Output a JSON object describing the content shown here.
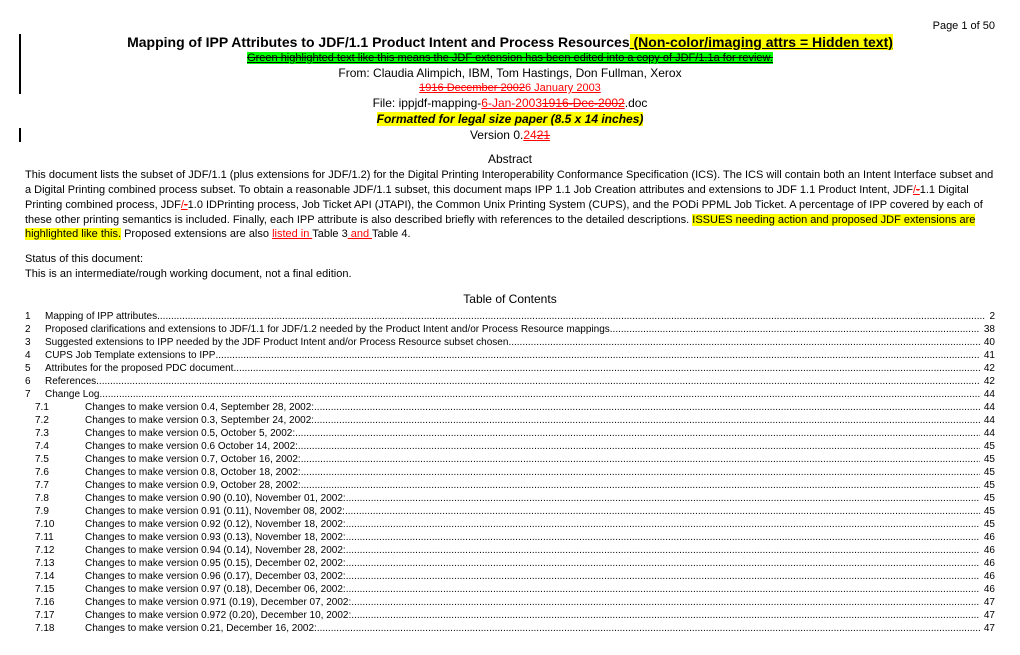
{
  "pageNum": "Page 1 of 50",
  "title": "Mapping of IPP Attributes to JDF/1.1 Product Intent and Process Resources",
  "titleSubtitle": " (Non-color/imaging attrs = Hidden text)",
  "greenLine": "Green highlighted text like this means the JDF extension has been edited into a copy of JDF/1.1a for review.",
  "fromLine": "From: Claudia Alimpich, IBM, Tom Hastings, Don Fullman, Xerox",
  "dateStrike1": "1916 December 2002",
  "dateNew": "6 January 2003",
  "filePrefix": "File: ippjdf-mapping-",
  "fileNew": "6-Jan-2003",
  "fileStrike": "1916-Dec-2002",
  "fileSuffix": ".doc",
  "formatLine": "Formatted for legal size paper (8.5 x 14 inches)",
  "versionPrefix": "Version  0.",
  "versionNew": "24",
  "versionOld": "21",
  "abstractTitle": "Abstract",
  "abstractText1": "This document lists the subset of JDF/1.1 (plus extensions for JDF/1.2) for the Digital Printing Interoperability Conformance Specification (ICS).  The ICS will contain both an Intent Interface subset and a Digital Printing combined process subset.  To obtain a reasonable JDF/1.1 subset, this document maps IPP 1.1 Job Creation attributes and extensions to JDF 1.1 Product Intent, JDF",
  "abstractSlash": "/-",
  "abstractText2": "1.1 Digital Printing combined process, JDF",
  "abstractSlash2": "/-",
  "abstractText3": "1.0 IDPrinting process, Job Ticket API (JTAPI),  the Common Unix Printing System (CUPS), and the PODi PPML Job Ticket.  A percentage of IPP covered by each of these other printing semantics is included.  Finally, each IPP attribute is also described briefly with references to the detailed descriptions.  ",
  "abstractHighlight": "ISSUES needing action and proposed JDF extensions are highlighted like this.",
  "abstractText4": "  Proposed extensions are also ",
  "abstractLink1": "listed in ",
  "abstractText5": "Table 3",
  "abstractLink2": " and ",
  "abstractText6": "Table 4.",
  "statusTitle": "Status of this document:",
  "statusText": "This is an intermediate/rough working document, not a final edition.",
  "tocTitle": "Table of Contents",
  "toc": [
    {
      "num": "1",
      "text": "Mapping of IPP attributes",
      "page": "2"
    },
    {
      "num": "2",
      "text": "Proposed clarifications and extensions to JDF/1.1 for JDF/1.2 needed by the Product Intent and/or Process Resource mappings",
      "page": "38"
    },
    {
      "num": "3",
      "text": "Suggested extensions to IPP needed by the JDF Product Intent and/or Process Resource subset chosen",
      "page": "40"
    },
    {
      "num": "4",
      "text": "CUPS Job Template extensions to IPP",
      "page": "41"
    },
    {
      "num": "5",
      "text": "Attributes for the proposed PDC document",
      "page": "42"
    },
    {
      "num": "6",
      "text": "References",
      "page": "42"
    },
    {
      "num": "7",
      "text": "Change Log",
      "page": "44"
    }
  ],
  "tocSub": [
    {
      "num": "7.1",
      "text": "Changes to make version 0.4, September 28, 2002:",
      "page": "44"
    },
    {
      "num": "7.2",
      "text": "Changes to make version 0.3, September 24, 2002:",
      "page": "44"
    },
    {
      "num": "7.3",
      "text": "Changes to make version 0.5, October 5, 2002:",
      "page": "44"
    },
    {
      "num": "7.4",
      "text": "Changes to make version 0.6 October 14, 2002:",
      "page": "45"
    },
    {
      "num": "7.5",
      "text": "Changes to make version 0.7, October 16, 2002:",
      "page": "45"
    },
    {
      "num": "7.6",
      "text": "Changes to make version 0.8, October 18, 2002:",
      "page": "45"
    },
    {
      "num": "7.7",
      "text": "Changes to make version 0.9, October 28, 2002:",
      "page": "45"
    },
    {
      "num": "7.8",
      "text": "Changes to make version 0.90 (0.10), November 01, 2002:",
      "page": "45"
    },
    {
      "num": "7.9",
      "text": "Changes to make version 0.91 (0.11), November 08, 2002:",
      "page": "45"
    },
    {
      "num": "7.10",
      "text": "Changes to make version 0.92 (0.12), November 18, 2002:",
      "page": "45"
    },
    {
      "num": "7.11",
      "text": "Changes to make version 0.93 (0.13), November 18, 2002:",
      "page": "46"
    },
    {
      "num": "7.12",
      "text": "Changes to make version 0.94 (0.14), November 28, 2002:",
      "page": "46"
    },
    {
      "num": "7.13",
      "text": "Changes to make version 0.95 (0.15), December 02, 2002:",
      "page": "46"
    },
    {
      "num": "7.14",
      "text": "Changes to make version 0.96 (0.17), December 03, 2002:",
      "page": "46"
    },
    {
      "num": "7.15",
      "text": "Changes to make version 0.97 (0.18), December 06, 2002:",
      "page": "46"
    },
    {
      "num": "7.16",
      "text": "Changes to make version 0.971 (0.19), December 07, 2002:",
      "page": "47"
    },
    {
      "num": "7.17",
      "text": "Changes to make version 0.972 (0.20), December 10, 2002:",
      "page": "47"
    },
    {
      "num": "7.18",
      "text": "Changes to make version 0.21, December 16, 2002:",
      "page": "47"
    }
  ]
}
